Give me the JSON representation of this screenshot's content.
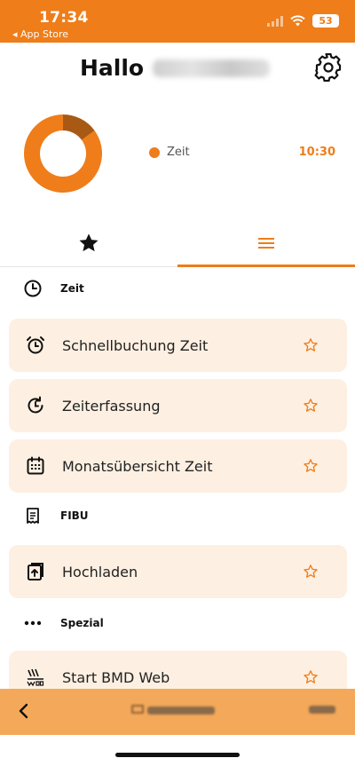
{
  "status_bar": {
    "time": "17:34",
    "back_app": "◂ App Store",
    "battery": "53"
  },
  "header": {
    "greeting": "Hallo"
  },
  "chart_data": {
    "type": "pie",
    "series": [
      {
        "name": "Zeit",
        "values": [
          0.15,
          0.85
        ]
      }
    ],
    "colors": [
      "#a85a15",
      "#ee7d1a"
    ]
  },
  "legend": {
    "label": "Zeit",
    "value": "10:30"
  },
  "sections": [
    {
      "title": "Zeit",
      "icon": "clock-icon",
      "items": [
        {
          "label": "Schnellbuchung Zeit",
          "icon": "alarm-clock-icon"
        },
        {
          "label": "Zeiterfassung",
          "icon": "refresh-clock-icon"
        },
        {
          "label": "Monatsübersicht Zeit",
          "icon": "calendar-icon"
        }
      ]
    },
    {
      "title": "FIBU",
      "icon": "receipt-icon",
      "items": [
        {
          "label": "Hochladen",
          "icon": "upload-icon"
        }
      ]
    },
    {
      "title": "Spezial",
      "icon": "more-dots-icon",
      "items": [
        {
          "label": "Start BMD Web",
          "icon": "web-icon"
        }
      ]
    }
  ],
  "colors": {
    "accent": "#ee7d1a",
    "card_bg": "#fdf0e2",
    "bottom_bar": "#f4a95a"
  }
}
